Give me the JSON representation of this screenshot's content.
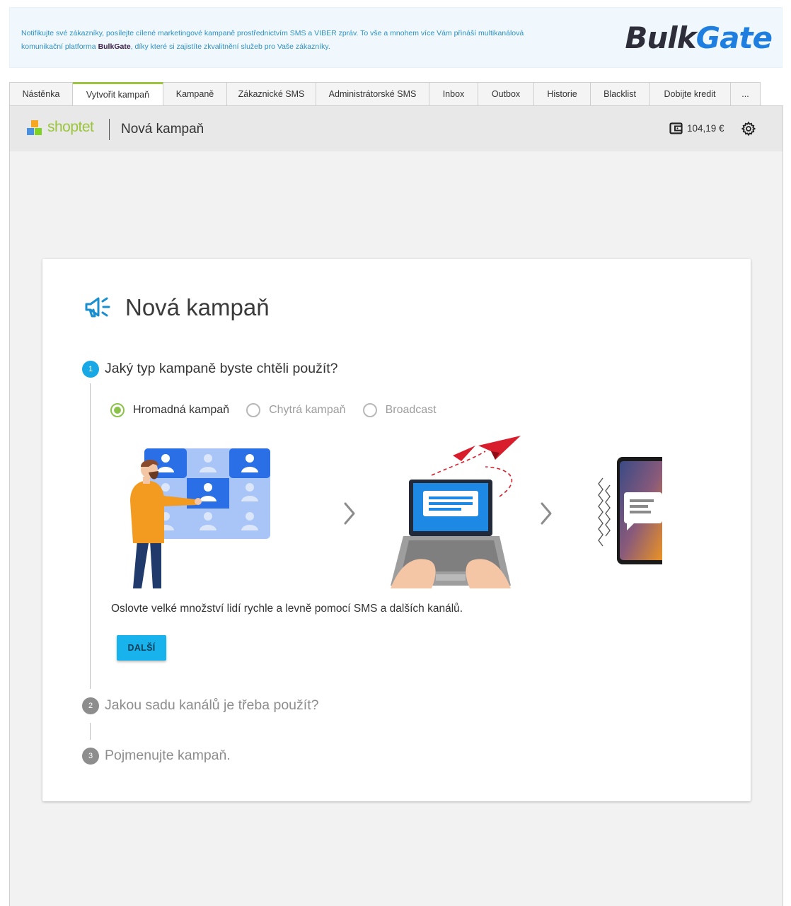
{
  "banner": {
    "text_part1": "Notifikujte své zákazníky, posílejte cílené marketingové kampaně prostřednictvím SMS a VIBER zpráv. To vše a mnohem více Vám přináší multikanálová komunikační platforma ",
    "brand_inline": "BulkGate",
    "text_part2": ", díky které si zajistíte zkvalitnění služeb pro Vaše zákazníky.",
    "logo_part1": "Bulk",
    "logo_part2": "Gate",
    "colors": {
      "logo_dark": "#2e2e3a",
      "logo_blue": "#1e7fe0",
      "text": "#2d8fc2"
    }
  },
  "tabs": [
    {
      "label": "Nástěnka",
      "active": false
    },
    {
      "label": "Vytvořit kampaň",
      "active": true
    },
    {
      "label": "Kampaně",
      "active": false
    },
    {
      "label": "Zákaznické SMS",
      "active": false
    },
    {
      "label": "Administrátorské SMS",
      "active": false
    },
    {
      "label": "Inbox",
      "active": false
    },
    {
      "label": "Outbox",
      "active": false
    },
    {
      "label": "Historie",
      "active": false
    },
    {
      "label": "Blacklist",
      "active": false
    },
    {
      "label": "Dobijte kredit",
      "active": false
    },
    {
      "label": "...",
      "active": false
    }
  ],
  "header": {
    "shop_name": "shoptet",
    "title": "Nová kampaň",
    "credit": "104,19 €",
    "icons": [
      "wallet-icon",
      "gear-icon"
    ]
  },
  "card": {
    "title": "Nová kampaň",
    "icon": "megaphone-icon",
    "steps": [
      {
        "num": "1",
        "label": "Jaký typ kampaně byste chtěli použít?",
        "active": true
      },
      {
        "num": "2",
        "label": "Jakou sadu kanálů je třeba použít?",
        "active": false
      },
      {
        "num": "3",
        "label": "Pojmenujte kampaň.",
        "active": false
      }
    ],
    "radios": [
      {
        "label": "Hromadná kampaň",
        "checked": true
      },
      {
        "label": "Chytrá kampaň",
        "checked": false
      },
      {
        "label": "Broadcast",
        "checked": false
      }
    ],
    "description": "Oslovte velké množství lidí rychle a levně pomocí SMS a dalších kanálů.",
    "next_button": "DALŠÍ"
  },
  "colors": {
    "accent_blue": "#18a8e6",
    "accent_green": "#8bc34a",
    "shoptet_green": "#9bc53d"
  }
}
